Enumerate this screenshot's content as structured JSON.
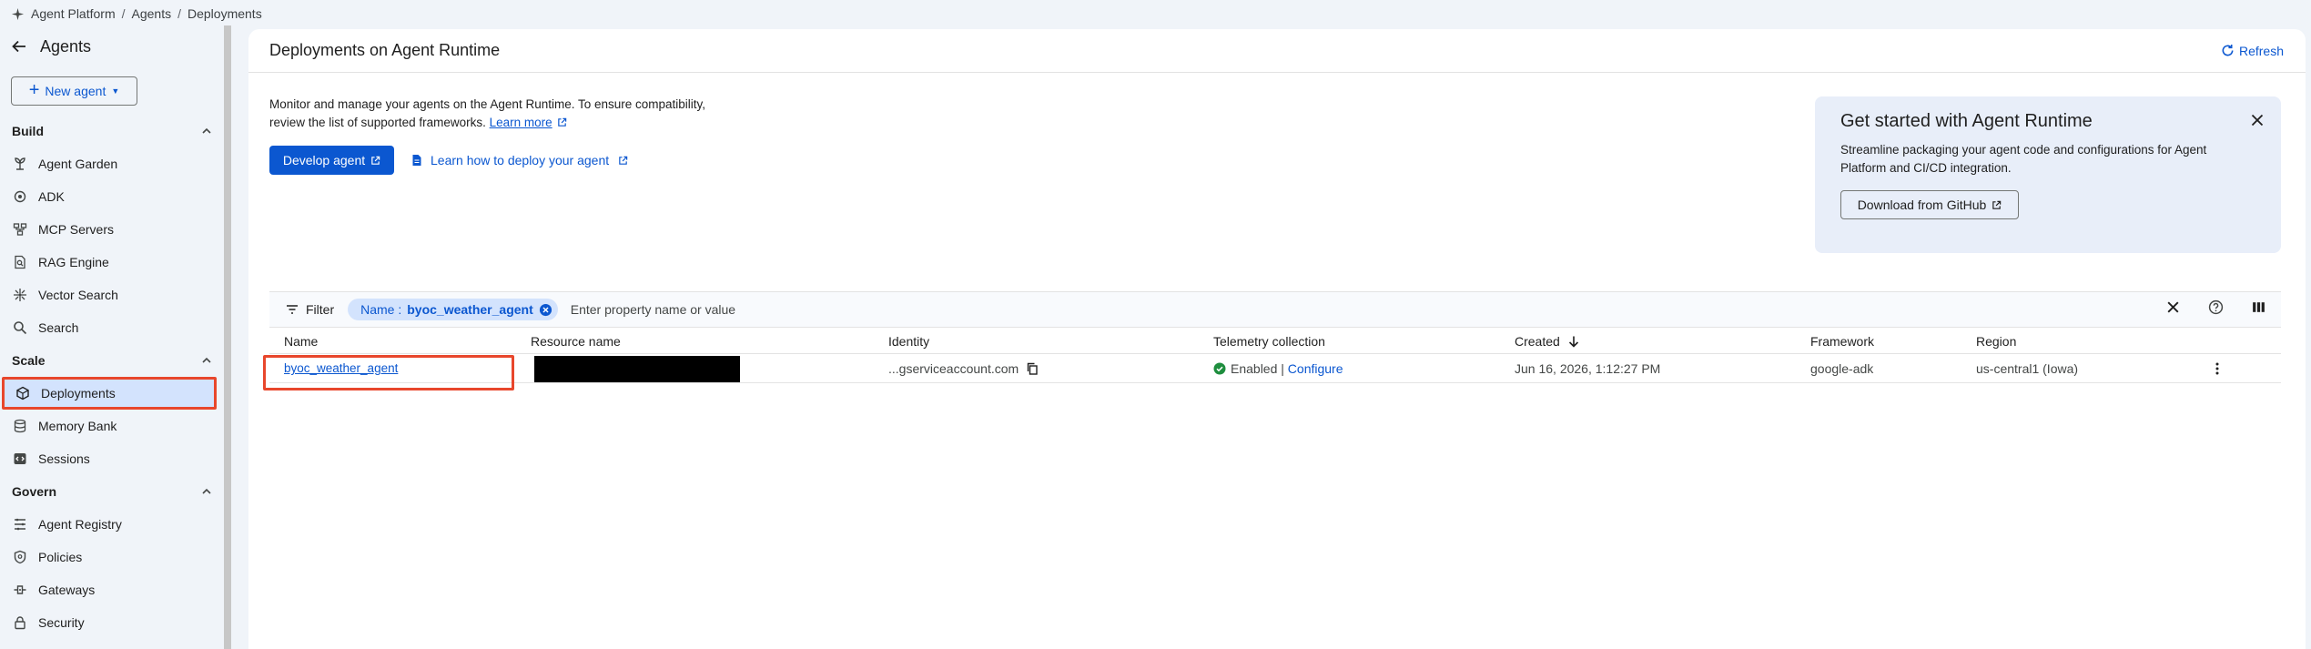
{
  "breadcrumb": {
    "icon": "agent-platform-sparkle-icon",
    "items": [
      "Agent Platform",
      "Agents",
      "Deployments"
    ],
    "separator": "/"
  },
  "sidebar": {
    "title": "Agents",
    "new_agent_label": "New agent",
    "sections": [
      {
        "label": "Build",
        "items": [
          "Agent Garden",
          "ADK",
          "MCP Servers",
          "RAG Engine",
          "Vector Search",
          "Search"
        ]
      },
      {
        "label": "Scale",
        "items": [
          "Deployments",
          "Memory Bank",
          "Sessions"
        ]
      },
      {
        "label": "Govern",
        "items": [
          "Agent Registry",
          "Policies",
          "Gateways",
          "Security"
        ]
      }
    ],
    "active_item": "Deployments"
  },
  "main": {
    "title": "Deployments on Agent Runtime",
    "refresh_label": "Refresh",
    "intro_line1": "Monitor and manage your agents on the Agent Runtime. To ensure compatibility,",
    "intro_line2": "review the list of supported frameworks.",
    "learn_more": "Learn more",
    "develop_agent": "Develop agent",
    "learn_deploy": "Learn how to deploy your agent"
  },
  "promo": {
    "title": "Get started with Agent Runtime",
    "description": "Streamline packaging your agent code and configurations for Agent Platform and CI/CD integration.",
    "button": "Download from GitHub"
  },
  "filter": {
    "label": "Filter",
    "chip_key": "Name :",
    "chip_value": "byoc_weather_agent",
    "placeholder": "Enter property name or value"
  },
  "table": {
    "columns": [
      "Name",
      "Resource name",
      "Identity",
      "Telemetry collection",
      "Created",
      "Framework",
      "Region"
    ],
    "rows": [
      {
        "name": "byoc_weather_agent",
        "resource_name": "",
        "identity": "...gserviceaccount.com",
        "telemetry_status": "Enabled |",
        "telemetry_action": "Configure",
        "created": "Jun 16, 2026, 1:12:27 PM",
        "framework": "google-adk",
        "region": "us-central1 (Iowa)"
      }
    ]
  },
  "colors": {
    "accent": "#0b57d0",
    "highlight": "#e8472c",
    "active_bg": "#d3e3fd",
    "success": "#1e8e3e"
  }
}
